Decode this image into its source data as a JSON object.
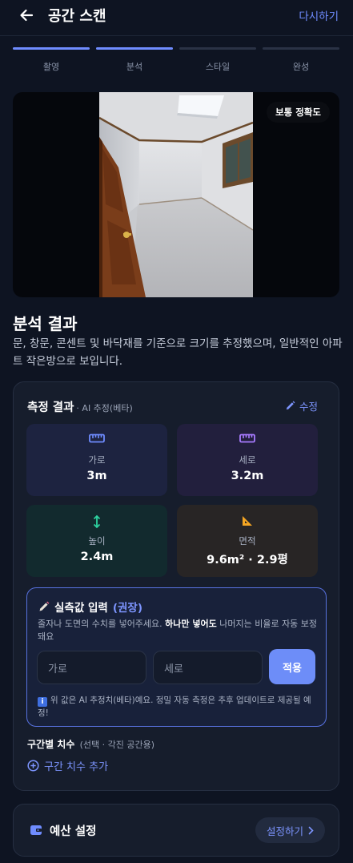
{
  "header": {
    "title": "공간 스캔",
    "redo_label": "다시하기"
  },
  "steps": [
    {
      "label": "촬영",
      "active": true
    },
    {
      "label": "분석",
      "active": true
    },
    {
      "label": "스타일",
      "active": false
    },
    {
      "label": "완성",
      "active": false
    }
  ],
  "photo": {
    "accuracy_badge": "보통 정확도"
  },
  "analysis": {
    "title": "분석 결과",
    "description": "문, 창문, 콘센트 및 바닥재를 기준으로 크기를 추정했으며, 일반적인 아파트 작은방으로 보입니다."
  },
  "measurement": {
    "title": "측정 결과",
    "subtitle": "· AI 추정(베타)",
    "edit_label": "수정",
    "width": {
      "label": "가로",
      "value": "3m"
    },
    "depth": {
      "label": "세로",
      "value": "3.2m"
    },
    "height": {
      "label": "높이",
      "value": "2.4m"
    },
    "area": {
      "label": "면적",
      "value": "9.6m² · 2.9평"
    }
  },
  "actual_input": {
    "title": "실측값 입력",
    "recommended": "(권장)",
    "desc_part1": "줄자나 도면의 수치를 넣어주세요. ",
    "desc_bold": "하나만 넣어도",
    "desc_part2": " 나머지는 비율로 자동 보정돼요",
    "width_placeholder": "가로",
    "depth_placeholder": "세로",
    "apply_label": "적용",
    "note": "위 값은 AI 추정치(베타)예요. 정밀 자동 측정은 추후 업데이트로 제공될 예정!"
  },
  "segment": {
    "title": "구간별 치수",
    "subtitle": "(선택 · 각진 공간용)",
    "add_label": "구간 치수 추가"
  },
  "budget": {
    "title": "예산 설정",
    "button_label": "설정하기"
  },
  "colors": {
    "accent": "#6f8cff",
    "background": "#0e1422",
    "card": "#161d2c"
  }
}
